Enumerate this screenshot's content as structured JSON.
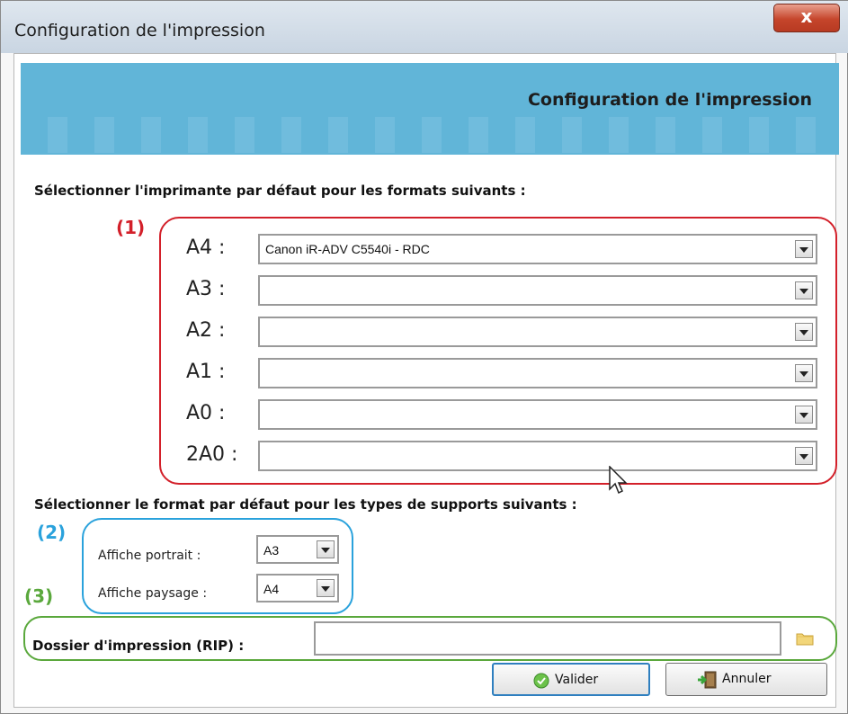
{
  "window": {
    "title": "Configuration de l'impression",
    "close_symbol": "x"
  },
  "banner": {
    "title": "Configuration de l'impression"
  },
  "section1": {
    "label": "Sélectionner l'imprimante par défaut pour les formats suivants :",
    "marker": "(1)",
    "rows": [
      {
        "label": "A4 :",
        "value": "Canon iR-ADV C5540i - RDC"
      },
      {
        "label": "A3 :",
        "value": ""
      },
      {
        "label": "A2 :",
        "value": ""
      },
      {
        "label": "A1 :",
        "value": ""
      },
      {
        "label": "A0 :",
        "value": ""
      },
      {
        "label": "2A0 :",
        "value": ""
      }
    ]
  },
  "section2": {
    "label": "Sélectionner le format par défaut pour les types de supports suivants :",
    "marker": "(2)",
    "portrait": {
      "label": "Affiche portrait :",
      "value": "A3"
    },
    "paysage": {
      "label": "Affiche paysage :",
      "value": "A4"
    }
  },
  "section3": {
    "marker": "(3)",
    "label": "Dossier d'impression (RIP) :",
    "value": ""
  },
  "buttons": {
    "valider": "Valider",
    "annuler": "Annuler"
  },
  "colors": {
    "marker1": "#d3202a",
    "marker2": "#2aa2dc",
    "marker3": "#5aa83c",
    "banner": "#61b5d8"
  },
  "icons": [
    "close-icon",
    "dropdown-arrow-icon",
    "folder-icon",
    "check-icon",
    "exit-door-icon",
    "mouse-cursor-icon"
  ]
}
